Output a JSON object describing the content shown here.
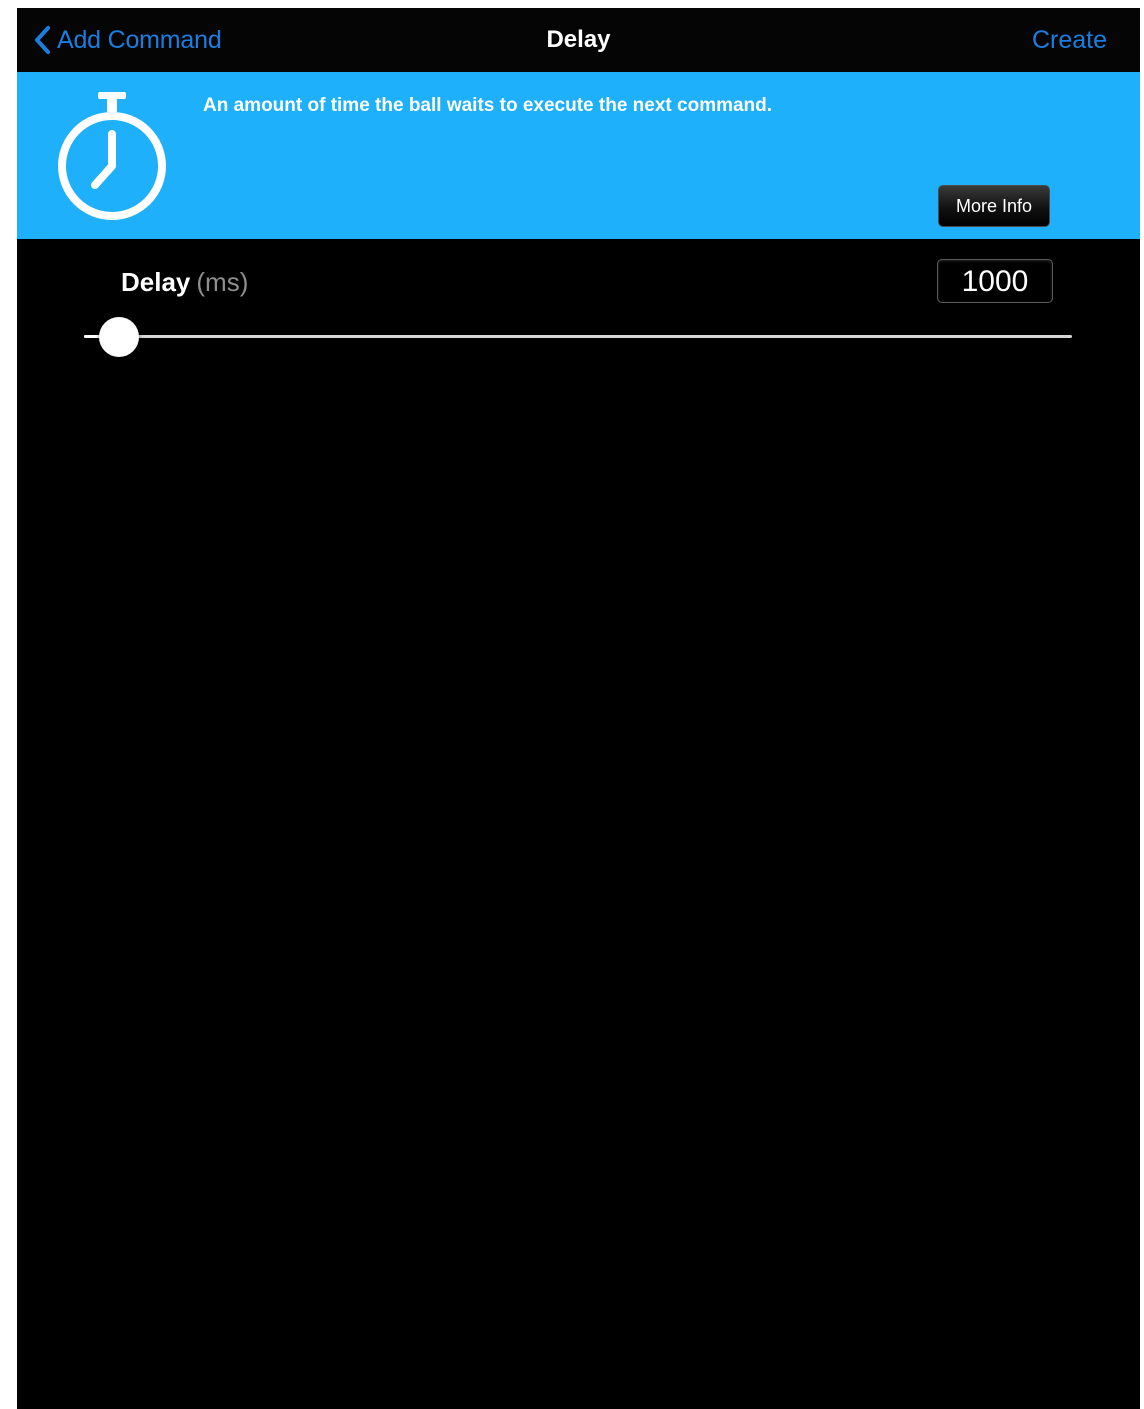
{
  "navbar": {
    "back_label": "Add Command",
    "title": "Delay",
    "create_label": "Create"
  },
  "banner": {
    "description": "An amount of time the ball waits to execute the next command.",
    "more_info_label": "More Info",
    "icon": "stopwatch-icon"
  },
  "delay": {
    "label": "Delay",
    "unit": "(ms)",
    "value": "1000",
    "slider_fraction": 0.0
  },
  "colors": {
    "accent": "#1a7ee0",
    "banner": "#1eb0fb",
    "background": "#000000"
  }
}
